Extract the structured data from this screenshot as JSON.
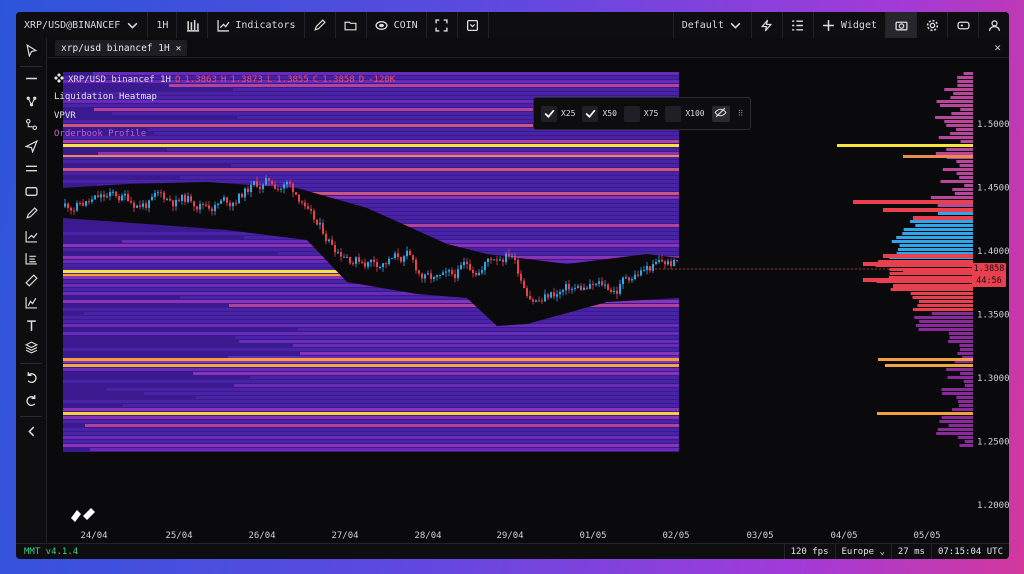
{
  "topbar": {
    "symbol": "XRP/USD@BINANCEF",
    "interval": "1H",
    "indicators_label": "Indicators",
    "coin_label": "COIN",
    "layout_label": "Default",
    "widget_label": "Widget"
  },
  "tab": {
    "label": "xrp/usd binancef 1H"
  },
  "legend": {
    "symbol_interval": "XRP/USD binancef 1H",
    "open_key": "O",
    "open": "1.3863",
    "high_key": "H",
    "high": "1.3873",
    "low_key": "L",
    "low": "1.3855",
    "close_key": "C",
    "close": "1.3858",
    "delta_key": "D",
    "delta": "-120K",
    "indicators": [
      "Liquidation Heatmap",
      "VPVR",
      "Orderbook Profile"
    ]
  },
  "filters": [
    {
      "label": "X25",
      "checked": true
    },
    {
      "label": "X50",
      "checked": true
    },
    {
      "label": "X75",
      "checked": false
    },
    {
      "label": "X100",
      "checked": false
    }
  ],
  "price_axis": [
    "1.5000",
    "1.4500",
    "1.4000",
    "1.3500",
    "1.3000",
    "1.2500",
    "1.2000"
  ],
  "date_axis": [
    "24/04",
    "25/04",
    "26/04",
    "27/04",
    "28/04",
    "29/04",
    "01/05",
    "02/05",
    "03/05",
    "04/05",
    "05/05"
  ],
  "current_price": {
    "value": "1.3858",
    "countdown": "44:56"
  },
  "status": {
    "version": "MMT v4.1.4",
    "fps": "120 fps",
    "region": "Europe",
    "latency": "27 ms",
    "time": "07:15:04 UTC"
  },
  "colors": {
    "up_candle": "#2ea6e8",
    "down_candle": "#e8404f",
    "heat_low": "#4b23a8",
    "heat_mid": "#a33fb0",
    "heat_high": "#f3e03a",
    "accent_green": "#3fd17a"
  },
  "icons": [
    "chevron-down-icon",
    "candles-icon",
    "line-chart-icon",
    "pencil-icon",
    "folder-icon",
    "coin-icon",
    "fullscreen-icon",
    "save-icon",
    "lightning-icon",
    "list-icon",
    "plus-icon",
    "camera-icon",
    "gear-icon",
    "gamepad-icon",
    "user-icon"
  ]
}
